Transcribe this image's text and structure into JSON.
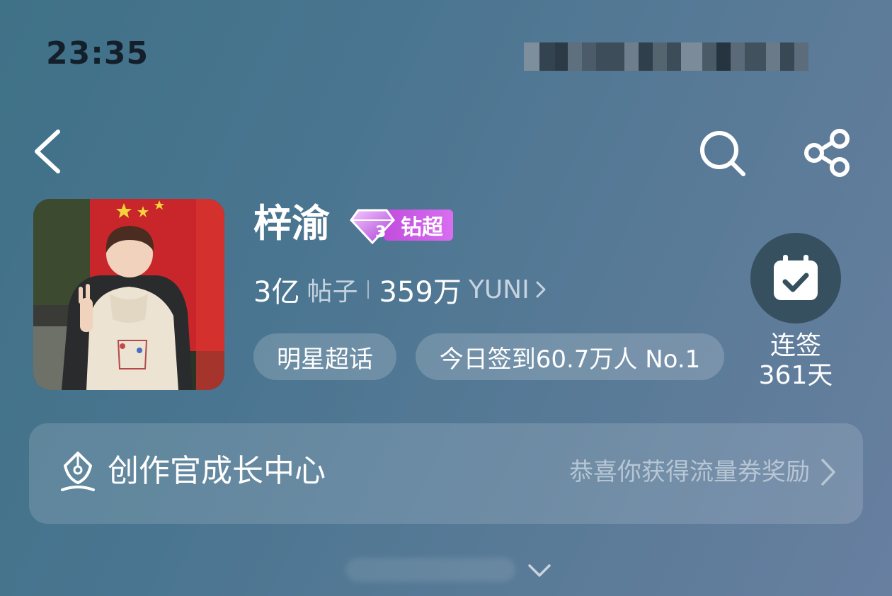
{
  "status_bar": {
    "time": "23:35"
  },
  "nav": {
    "back_icon": "chevron-left-icon",
    "search_icon": "search-icon",
    "share_icon": "share-icon"
  },
  "profile": {
    "name": "梓渝",
    "badge_label": "钻超",
    "badge_level": "3",
    "stats": {
      "posts_value": "3亿",
      "posts_label": "帖子",
      "fans_value": "359万",
      "fans_label": "YUNI"
    },
    "chips": {
      "category": "明星超话",
      "checkin_rank": "今日签到60.7万人 No.1"
    },
    "checkin": {
      "line1": "连签",
      "line2": "361天"
    }
  },
  "banner": {
    "title": "创作官成长中心",
    "subtitle": "恭喜你获得流量券奖励"
  },
  "colors": {
    "background_start": "#3f7187",
    "background_end": "#687fa0",
    "badge_purple": "#c14ddd",
    "checkin_circle": "#37505f"
  }
}
